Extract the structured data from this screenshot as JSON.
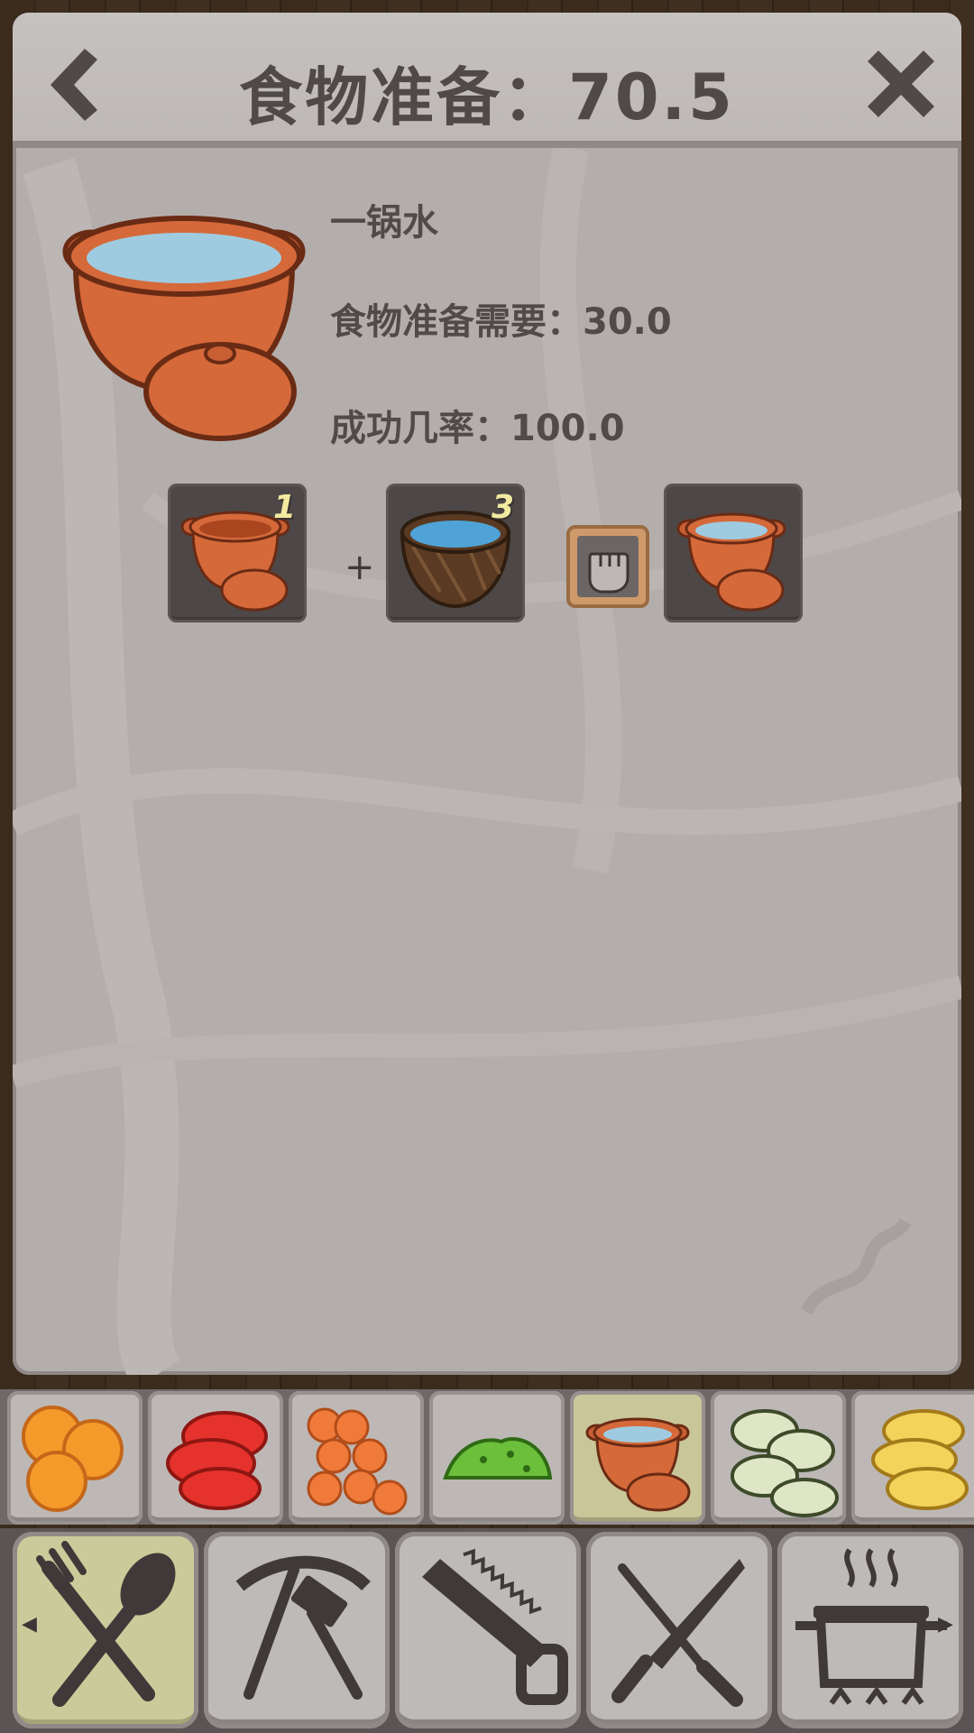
{
  "header": {
    "title": "食物准备：70.5",
    "back_icon": "chevron-left-icon",
    "close_icon": "close-icon"
  },
  "recipe": {
    "name": "一锅水",
    "requirement": "食物准备需要：30.0",
    "success_rate": "成功几率：100.0",
    "hero_icon": "clay-pot-water-icon"
  },
  "ingredients": [
    {
      "icon": "empty-clay-pot-icon",
      "quantity": "1"
    },
    {
      "icon": "coconut-water-icon",
      "quantity": "3"
    }
  ],
  "plus_sign": "+",
  "craft_icon": "fist-icon",
  "result_icon": "clay-pot-water-icon",
  "ingredient_strip": [
    {
      "icon": "orange-slices-icon",
      "active": false
    },
    {
      "icon": "tomato-slices-icon",
      "active": false
    },
    {
      "icon": "carrot-slices-icon",
      "active": false
    },
    {
      "icon": "chopped-herbs-icon",
      "active": false
    },
    {
      "icon": "clay-pot-water-icon",
      "active": true
    },
    {
      "icon": "cucumber-slices-icon",
      "active": false
    },
    {
      "icon": "potato-slices-icon",
      "active": false
    }
  ],
  "category_tabs": [
    {
      "icon": "fork-spoon-icon",
      "active": true
    },
    {
      "icon": "pickaxe-hammer-icon",
      "active": false
    },
    {
      "icon": "saw-icon",
      "active": false
    },
    {
      "icon": "crossed-knives-icon",
      "active": false
    },
    {
      "icon": "cooking-pot-icon",
      "active": false
    }
  ],
  "colors": {
    "panel": "#b3aeac",
    "text": "#514a49",
    "slot": "#4d4847",
    "active_tile": "#c9c79a",
    "pot": "#d5693a",
    "water": "#9fcbe0"
  }
}
